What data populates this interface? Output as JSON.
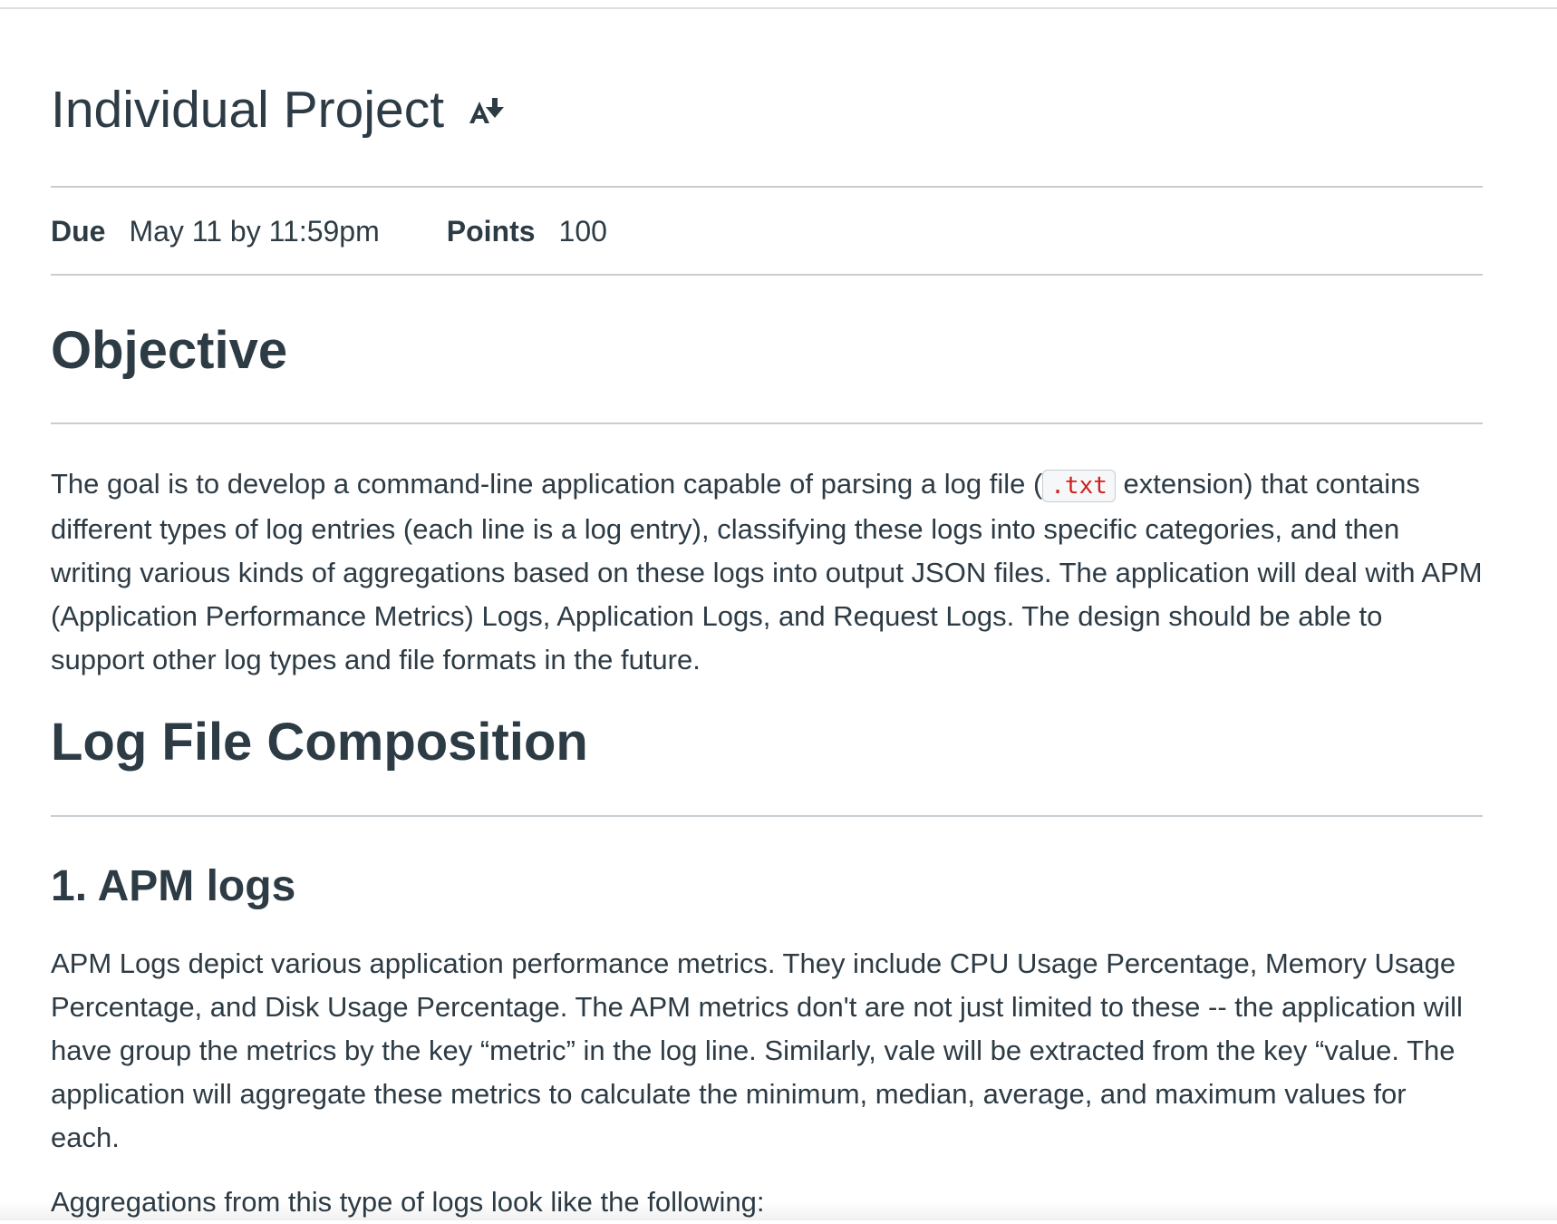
{
  "assignment": {
    "title": "Individual Project",
    "immersive_reader_icon": "immersive-reader-icon",
    "due_label": "Due",
    "due_value": "May 11 by 11:59pm",
    "points_label": "Points",
    "points_value": "100"
  },
  "objective": {
    "heading": "Objective",
    "text_before_code": "The goal is to develop a command-line application capable of parsing a log file (",
    "code": ".txt",
    "text_after_code": " extension) that contains different types of log entries (each line is a log entry),  classifying these logs into specific categories, and then writing various kinds of aggregations based on these logs into output JSON files. The application will deal with APM (Application Performance Metrics) Logs, Application Logs, and Request Logs. The design should be able to support other log types and file formats in the future."
  },
  "log_file_composition": {
    "heading": "Log File Composition"
  },
  "apm_logs": {
    "heading": "1. APM logs",
    "paragraph": "APM Logs depict various application performance metrics. They include CPU Usage Percentage, Memory Usage Percentage, and Disk Usage Percentage. The APM metrics don't are not just limited to these --  the application will have group the metrics by the key “metric” in the log line. Similarly, vale will be extracted from the key “value. The application will aggregate these metrics to calculate the minimum, median, average, and maximum values for each.",
    "aggregations_intro": "Aggregations from this type of logs look like the following:"
  },
  "colors": {
    "text": "#2d3b45",
    "rule": "#c7cdd1",
    "code_text": "#d11f1f",
    "code_bg": "#f6f7f8"
  }
}
